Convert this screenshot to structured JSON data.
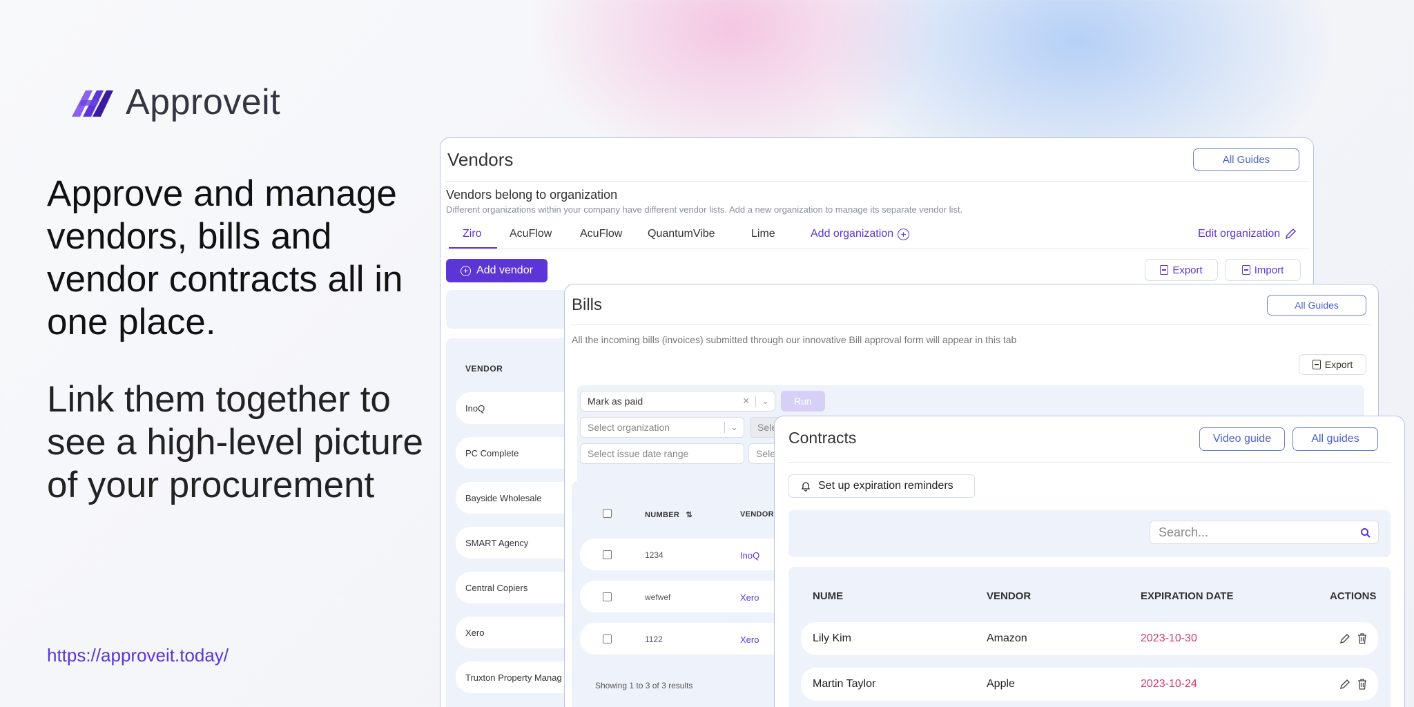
{
  "brand": {
    "name": "Approveit",
    "colors": {
      "primary": "#5b35d5",
      "logo_dark": "#3b1c9e",
      "logo_light": "#8b62f0",
      "date_red": "#d33a6a"
    }
  },
  "hero": {
    "headline": "Approve and manage vendors, bills and vendor contracts all in one place.",
    "subline": "Link them together to see a high-level picture of your procurement",
    "url": "https://approveit.today/"
  },
  "vendors": {
    "title": "Vendors",
    "all_guides": "All Guides",
    "section_title": "Vendors belong to organization",
    "section_desc": "Different organizations within your company have different vendor lists. Add a new organization to manage its separate vendor list.",
    "tabs": [
      "Ziro",
      "AcuFlow",
      "AcuFlow",
      "QuantumVibe",
      "Lime"
    ],
    "add_org": "Add organization",
    "edit_org": "Edit organization",
    "add_vendor": "Add vendor",
    "export": "Export",
    "import": "Import",
    "column_vendor": "VENDOR",
    "rows": [
      "InoQ",
      "PC Complete",
      "Bayside Wholesale",
      "SMART Agency",
      "Central Copiers",
      "Xero",
      "Truxton Property Manag"
    ]
  },
  "bills": {
    "title": "Bills",
    "all_guides": "All Guides",
    "desc": "All the incoming bills (invoices) submitted through our innovative Bill approval form will appear in this tab",
    "export": "Export",
    "action_select": "Mark as paid",
    "run": "Run",
    "org_placeholder": "Select organization",
    "org2_placeholder": "Sele",
    "date_placeholder": "Select issue date range",
    "date2_placeholder": "Sele",
    "columns": {
      "number": "NUMBER",
      "vendor": "VENDOR"
    },
    "rows": [
      {
        "number": "1234",
        "vendor": "InoQ"
      },
      {
        "number": "wefwef",
        "vendor": "Xero"
      },
      {
        "number": "1122",
        "vendor": "Xero"
      }
    ],
    "showing": "Showing 1 to 3 of 3 results"
  },
  "contracts": {
    "title": "Contracts",
    "video_guide": "Video guide",
    "all_guides": "All guides",
    "reminder": "Set up expiration reminders",
    "search_placeholder": "Search...",
    "columns": {
      "name": "NUME",
      "vendor": "VENDOR",
      "expiration": "EXPIRATION DATE",
      "actions": "ACTIONS"
    },
    "rows": [
      {
        "name": "Lily Kim",
        "vendor": "Amazon",
        "expiration": "2023-10-30"
      },
      {
        "name": "Martin Taylor",
        "vendor": "Apple",
        "expiration": "2023-10-24"
      }
    ]
  }
}
